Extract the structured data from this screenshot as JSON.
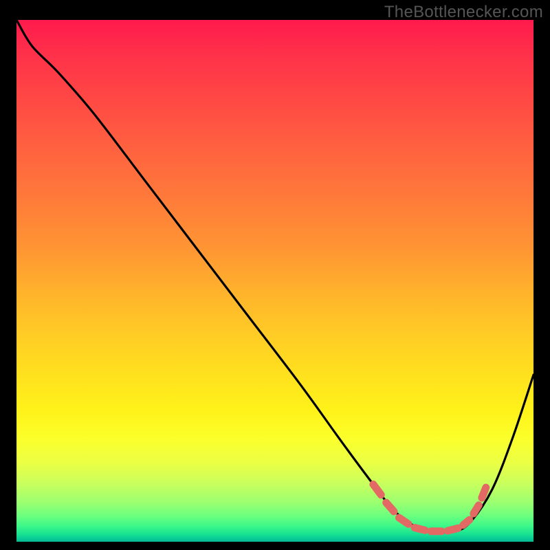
{
  "watermark": "TheBottlenecker.com",
  "chart_data": {
    "type": "line",
    "title": "",
    "xlabel": "",
    "ylabel": "",
    "xlim": [
      0,
      100
    ],
    "ylim": [
      0,
      100
    ],
    "grid": false,
    "legend": false,
    "background_gradient": {
      "top": "#ff1a4d",
      "bottom": "#07b892"
    },
    "series": [
      {
        "name": "bottleneck-curve",
        "color": "#000000",
        "x": [
          0,
          3,
          8,
          15,
          25,
          35,
          45,
          55,
          63,
          69,
          73,
          77,
          81,
          85,
          88,
          92,
          96,
          100
        ],
        "y": [
          100,
          95,
          90,
          82,
          69,
          56,
          43,
          30,
          19,
          11,
          6,
          3,
          2,
          2,
          4,
          10,
          20,
          32
        ]
      }
    ],
    "highlight_dashes": {
      "color": "#e36a64",
      "segments": [
        {
          "x0": 69.0,
          "y0": 11.0,
          "x1": 70.5,
          "y1": 9.0
        },
        {
          "x0": 71.5,
          "y0": 7.5,
          "x1": 73.0,
          "y1": 5.8
        },
        {
          "x0": 74.0,
          "y0": 4.6,
          "x1": 75.8,
          "y1": 3.4
        },
        {
          "x0": 77.0,
          "y0": 2.7,
          "x1": 79.0,
          "y1": 2.2
        },
        {
          "x0": 80.2,
          "y0": 2.0,
          "x1": 82.2,
          "y1": 2.0
        },
        {
          "x0": 83.4,
          "y0": 2.1,
          "x1": 85.4,
          "y1": 2.6
        },
        {
          "x0": 86.4,
          "y0": 3.2,
          "x1": 87.6,
          "y1": 4.2
        },
        {
          "x0": 88.4,
          "y0": 5.4,
          "x1": 89.4,
          "y1": 7.0
        },
        {
          "x0": 90.0,
          "y0": 8.4,
          "x1": 90.8,
          "y1": 10.4
        }
      ]
    }
  }
}
